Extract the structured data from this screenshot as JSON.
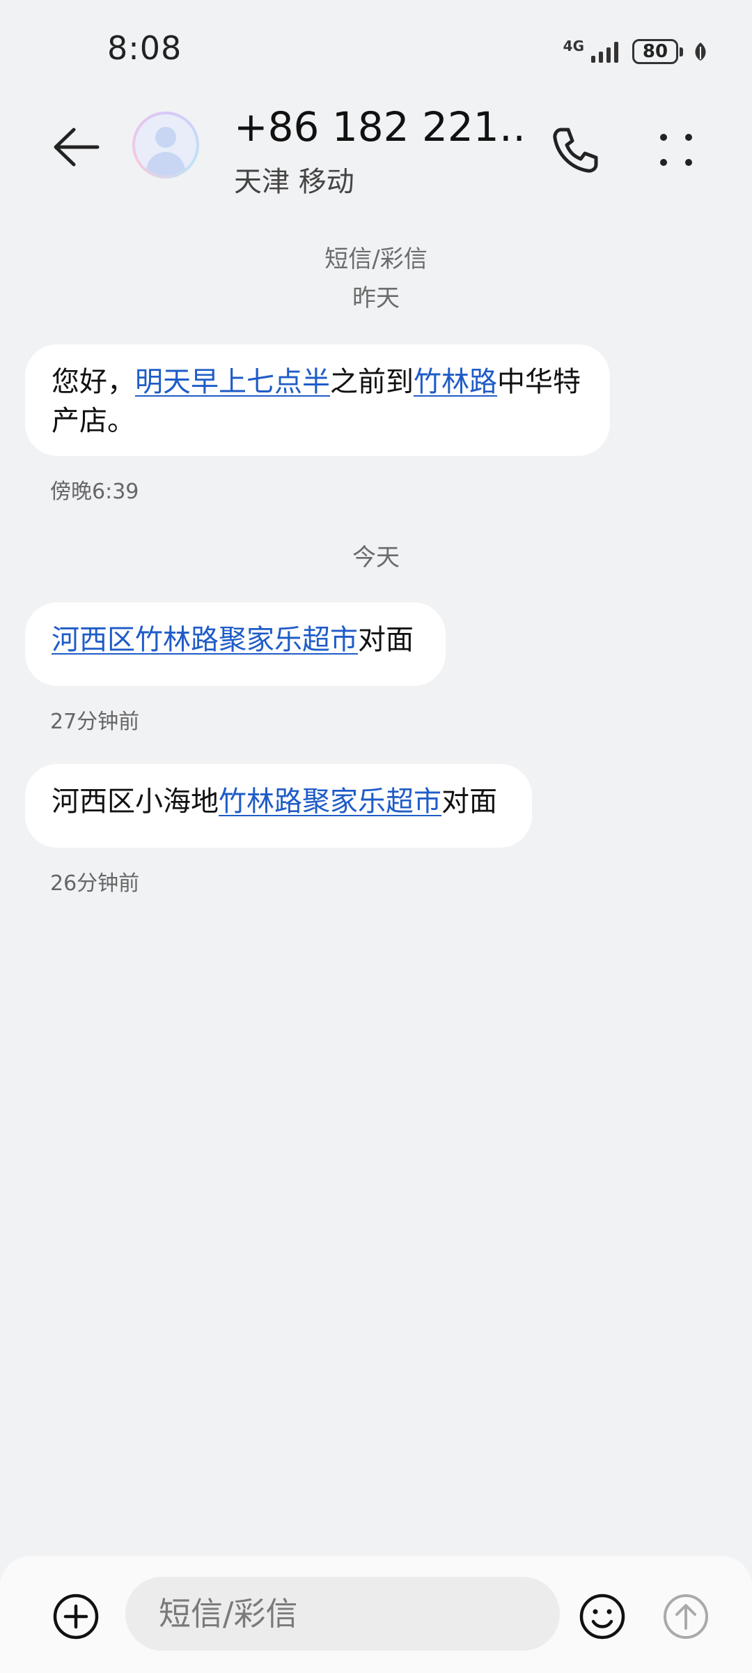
{
  "status_bar": {
    "time": "8:08",
    "network": "4G",
    "battery": "80",
    "signal_bars": 4
  },
  "header": {
    "contact_name": "+86 182 221…",
    "contact_sub": "天津 移动"
  },
  "conversation": {
    "channel_label": "短信/彩信",
    "groups": [
      {
        "date_label": "昨天",
        "messages": [
          {
            "text": "您好，明天早上七点半之前到竹林路中华特产店。",
            "segments": [
              {
                "text": "您好，",
                "link": false
              },
              {
                "text": "明天早上七点半",
                "link": true
              },
              {
                "text": "之前到",
                "link": false
              },
              {
                "text": "竹林路",
                "link": true
              },
              {
                "text": "中华特产店。",
                "link": false
              }
            ],
            "time": "傍晚6:39"
          }
        ]
      },
      {
        "date_label": "今天",
        "messages": [
          {
            "text": "河西区竹林路聚家乐超市对面",
            "segments": [
              {
                "text": "河西区竹林路聚家乐超市",
                "link": true
              },
              {
                "text": "对面",
                "link": false
              }
            ],
            "time": "27分钟前"
          },
          {
            "text": "河西区小海地竹林路聚家乐超市对面",
            "segments": [
              {
                "text": "河西区小海地",
                "link": false
              },
              {
                "text": "竹林路聚家乐超市",
                "link": true
              },
              {
                "text": "对面",
                "link": false
              }
            ],
            "time": "26分钟前"
          }
        ]
      }
    ]
  },
  "composer": {
    "placeholder": "短信/彩信"
  },
  "colors": {
    "background": "#f1f2f4",
    "bubble": "#ffffff",
    "link": "#1f5cc7",
    "secondary_text": "#6b6b6b"
  },
  "icons": [
    "back-arrow-icon",
    "avatar-icon",
    "phone-icon",
    "more-icon",
    "add-icon",
    "emoji-icon",
    "send-icon"
  ]
}
